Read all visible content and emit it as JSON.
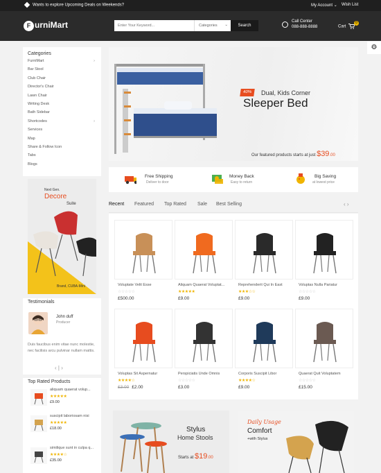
{
  "topbar": {
    "promo": "Wants to explore Upcoming Deals on Weekends?",
    "account": "My Account",
    "wishlist": "Wish List"
  },
  "header": {
    "logo_letter": "F",
    "logo_rest": "urniMart",
    "search_placeholder": "Enter Your Keyword...",
    "category_select": "Categories",
    "search_button": "Search",
    "call_label": "Call Center",
    "call_number": "088-888-8888",
    "cart_label": "Cart",
    "cart_count": "0"
  },
  "categories": {
    "title": "Categories",
    "items": [
      {
        "label": "FurniMart",
        "arrow": "›"
      },
      {
        "label": "Bar Stool",
        "arrow": ""
      },
      {
        "label": "Club Chair",
        "arrow": ""
      },
      {
        "label": "Director's Chair",
        "arrow": ""
      },
      {
        "label": "Lawn Chair",
        "arrow": ""
      },
      {
        "label": "Writing Desk",
        "arrow": ""
      },
      {
        "label": "Bath Sidebar",
        "arrow": ""
      },
      {
        "label": "Shortcodes",
        "arrow": "›"
      },
      {
        "label": "Services",
        "arrow": ""
      },
      {
        "label": "Map",
        "arrow": ""
      },
      {
        "label": "Share & Follow Icon",
        "arrow": ""
      },
      {
        "label": "Tabs",
        "arrow": ""
      },
      {
        "label": "Blogs",
        "arrow": ""
      }
    ]
  },
  "side_banner": {
    "eyebrow": "Next Gen.",
    "title": "Decore",
    "subtitle": "Suite",
    "brand": "Brand, CUBA-Mini"
  },
  "testimonials": {
    "title": "Testimonials",
    "name": "John duff",
    "role": "Producer",
    "quote": "Duis faucibus enim vitae nunc molestie, nec facilisis arcu pulvinar nullam mattis.",
    "nav": "‹ | ›"
  },
  "top_rated": {
    "title": "Top Rated Products",
    "items": [
      {
        "name": "aliquam quaerat volup...",
        "stars": "★★★★★",
        "price": "£9.00"
      },
      {
        "name": "suscipit laboriosam nisi",
        "stars": "★★★★★",
        "price": "£18.00"
      },
      {
        "name": "similique sunt in culpa q...",
        "stars": "★★★★☆",
        "price": "£35.00"
      }
    ]
  },
  "hero": {
    "badge": "40%",
    "line1": "Dual, Kids Corner",
    "line2": "Sleeper Bed",
    "price_text": "Our featured products starts at just",
    "price_symbol": "$",
    "price_main": "39",
    "price_cents": ".00"
  },
  "features": [
    {
      "title": "Free Shipping",
      "sub": "Deliver to door"
    },
    {
      "title": "Money Back",
      "sub": "Easy to return"
    },
    {
      "title": "Big Saving",
      "sub": "at lowest price"
    }
  ],
  "tabs": [
    "Recent",
    "Featured",
    "Top Rated",
    "Sale",
    "Best Selling"
  ],
  "tab_nav": "‹ ›",
  "products": [
    {
      "name": "Voluptate Velit Esse",
      "stars": "☆☆☆☆☆",
      "filled": false,
      "old": "",
      "price": "£500.00"
    },
    {
      "name": "Aliquam Quaerat Voluptat...",
      "stars": "★★★★★",
      "filled": true,
      "old": "",
      "price": "£9.00"
    },
    {
      "name": "Reprehenderit Qui In East",
      "stars": "★★★☆☆",
      "filled": true,
      "old": "",
      "price": "£9.00"
    },
    {
      "name": "Voluptas Nulla Pariatur",
      "stars": "☆☆☆☆☆",
      "filled": false,
      "old": "",
      "price": "£9.00"
    },
    {
      "name": "Voluptas Sit Aspernatur",
      "stars": "★★★★☆",
      "filled": true,
      "old": "£3.00",
      "price": "£2.00"
    },
    {
      "name": "Perspiciatis Unde Omnis",
      "stars": "☆☆☆☆☆",
      "filled": false,
      "old": "",
      "price": "£3.00"
    },
    {
      "name": "Corporis Suscipit Libor",
      "stars": "★★★★☆",
      "filled": true,
      "old": "",
      "price": "£9.00"
    },
    {
      "name": "Quaerat Quit Voluptatem",
      "stars": "☆☆☆☆☆",
      "filled": false,
      "old": "",
      "price": "£15.00"
    }
  ],
  "promo_stools": {
    "title": "Stylus",
    "subtitle": "Home Stools",
    "price_text": "Starts at",
    "price_symbol": "$",
    "price_main": "19",
    "price_cents": ".00"
  },
  "promo_comfort": {
    "eyebrow": "Daily Usage",
    "title": "Comfort",
    "subtitle": "+with Stylus"
  },
  "colors": {
    "accent": "#e74c1f",
    "dark": "#2b2b2b",
    "star": "#f0b400"
  }
}
